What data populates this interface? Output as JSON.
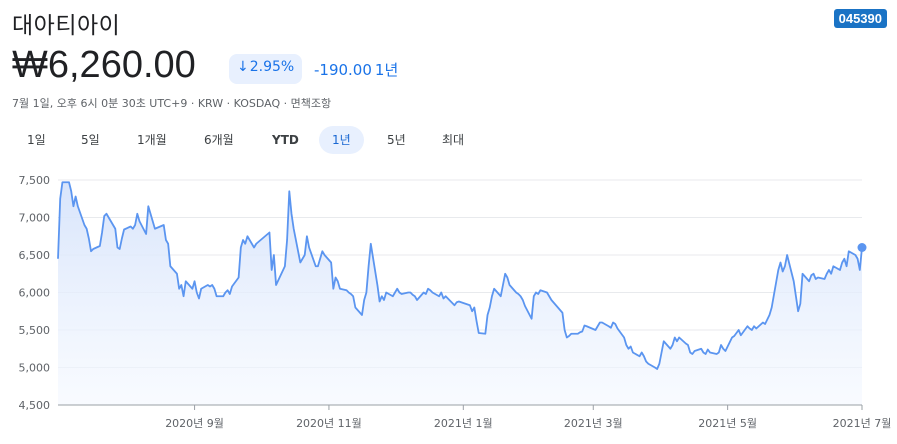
{
  "stock": {
    "name": "대아티아이",
    "ticker": "045390",
    "price": "₩6,260.00",
    "change_pct": "2.95%",
    "change_abs": "-190.00",
    "period": "1년",
    "meta": "7월 1일, 오후 6시 0분 30초 UTC+9 · KRW · KOSDAQ · 면책조항"
  },
  "tabs": [
    {
      "label": "1일"
    },
    {
      "label": "5일"
    },
    {
      "label": "1개월"
    },
    {
      "label": "6개월"
    },
    {
      "label": "YTD"
    },
    {
      "label": "1년",
      "active": true
    },
    {
      "label": "5년"
    },
    {
      "label": "최대"
    }
  ],
  "colors": {
    "line": "#5b95f0",
    "fill": "#e6eefc",
    "accent": "#1a73e8",
    "badge": "#1a73c5"
  },
  "chart_data": {
    "type": "area",
    "ylim": [
      4500,
      7500
    ],
    "yticks": [
      7500,
      7000,
      6500,
      6000,
      5500,
      5000,
      4500
    ],
    "ytick_labels": [
      "7,500",
      "7,000",
      "6,500",
      "6,000",
      "5,500",
      "5,000",
      "4,500"
    ],
    "xlim": [
      "2020-07-01",
      "2021-07-01"
    ],
    "xticks": [
      {
        "date": "2020-09-01",
        "label": "2020년 9월"
      },
      {
        "date": "2020-11-01",
        "label": "2020년 11월"
      },
      {
        "date": "2021-01-01",
        "label": "2021년 1월"
      },
      {
        "date": "2021-03-01",
        "label": "2021년 3월"
      },
      {
        "date": "2021-05-01",
        "label": "2021년 5월"
      },
      {
        "date": "2021-07-01",
        "label": "2021년 7월"
      }
    ],
    "x": [
      "2020-07-01",
      "2020-07-02",
      "2020-07-03",
      "2020-07-06",
      "2020-07-07",
      "2020-07-08",
      "2020-07-09",
      "2020-07-10",
      "2020-07-13",
      "2020-07-14",
      "2020-07-15",
      "2020-07-16",
      "2020-07-17",
      "2020-07-20",
      "2020-07-21",
      "2020-07-22",
      "2020-07-23",
      "2020-07-24",
      "2020-07-27",
      "2020-07-28",
      "2020-07-29",
      "2020-07-30",
      "2020-07-31",
      "2020-08-03",
      "2020-08-04",
      "2020-08-05",
      "2020-08-06",
      "2020-08-07",
      "2020-08-10",
      "2020-08-11",
      "2020-08-12",
      "2020-08-13",
      "2020-08-14",
      "2020-08-18",
      "2020-08-19",
      "2020-08-20",
      "2020-08-21",
      "2020-08-24",
      "2020-08-25",
      "2020-08-26",
      "2020-08-27",
      "2020-08-28",
      "2020-08-31",
      "2020-09-01",
      "2020-09-02",
      "2020-09-03",
      "2020-09-04",
      "2020-09-07",
      "2020-09-08",
      "2020-09-09",
      "2020-09-10",
      "2020-09-11",
      "2020-09-14",
      "2020-09-15",
      "2020-09-16",
      "2020-09-17",
      "2020-09-18",
      "2020-09-21",
      "2020-09-22",
      "2020-09-23",
      "2020-09-24",
      "2020-09-25",
      "2020-09-28",
      "2020-09-29",
      "2020-10-05",
      "2020-10-06",
      "2020-10-07",
      "2020-10-08",
      "2020-10-12",
      "2020-10-13",
      "2020-10-14",
      "2020-10-15",
      "2020-10-16",
      "2020-10-19",
      "2020-10-20",
      "2020-10-21",
      "2020-10-22",
      "2020-10-23",
      "2020-10-26",
      "2020-10-27",
      "2020-10-28",
      "2020-10-29",
      "2020-10-30",
      "2020-11-02",
      "2020-11-03",
      "2020-11-04",
      "2020-11-05",
      "2020-11-06",
      "2020-11-09",
      "2020-11-10",
      "2020-11-11",
      "2020-11-12",
      "2020-11-13",
      "2020-11-16",
      "2020-11-17",
      "2020-11-18",
      "2020-11-19",
      "2020-11-20",
      "2020-11-23",
      "2020-11-24",
      "2020-11-25",
      "2020-11-26",
      "2020-11-27",
      "2020-11-30",
      "2020-12-01",
      "2020-12-02",
      "2020-12-03",
      "2020-12-04",
      "2020-12-07",
      "2020-12-08",
      "2020-12-09",
      "2020-12-10",
      "2020-12-11",
      "2020-12-14",
      "2020-12-15",
      "2020-12-16",
      "2020-12-17",
      "2020-12-18",
      "2020-12-21",
      "2020-12-22",
      "2020-12-23",
      "2020-12-24",
      "2020-12-28",
      "2020-12-29",
      "2020-12-30",
      "2021-01-04",
      "2021-01-05",
      "2021-01-06",
      "2021-01-07",
      "2021-01-08",
      "2021-01-11",
      "2021-01-12",
      "2021-01-13",
      "2021-01-14",
      "2021-01-15",
      "2021-01-18",
      "2021-01-19",
      "2021-01-20",
      "2021-01-21",
      "2021-01-22",
      "2021-01-25",
      "2021-01-26",
      "2021-01-27",
      "2021-01-28",
      "2021-01-29",
      "2021-02-01",
      "2021-02-02",
      "2021-02-03",
      "2021-02-04",
      "2021-02-05",
      "2021-02-08",
      "2021-02-09",
      "2021-02-10",
      "2021-02-15",
      "2021-02-16",
      "2021-02-17",
      "2021-02-18",
      "2021-02-19",
      "2021-02-22",
      "2021-02-23",
      "2021-02-24",
      "2021-02-25",
      "2021-02-26",
      "2021-03-02",
      "2021-03-03",
      "2021-03-04",
      "2021-03-05",
      "2021-03-08",
      "2021-03-09",
      "2021-03-10",
      "2021-03-11",
      "2021-03-12",
      "2021-03-15",
      "2021-03-16",
      "2021-03-17",
      "2021-03-18",
      "2021-03-19",
      "2021-03-22",
      "2021-03-23",
      "2021-03-24",
      "2021-03-25",
      "2021-03-26",
      "2021-03-29",
      "2021-03-30",
      "2021-03-31",
      "2021-04-01",
      "2021-04-02",
      "2021-04-05",
      "2021-04-06",
      "2021-04-07",
      "2021-04-08",
      "2021-04-09",
      "2021-04-12",
      "2021-04-13",
      "2021-04-14",
      "2021-04-15",
      "2021-04-16",
      "2021-04-19",
      "2021-04-20",
      "2021-04-21",
      "2021-04-22",
      "2021-04-23",
      "2021-04-26",
      "2021-04-27",
      "2021-04-28",
      "2021-04-29",
      "2021-04-30",
      "2021-05-03",
      "2021-05-04",
      "2021-05-06",
      "2021-05-07",
      "2021-05-10",
      "2021-05-11",
      "2021-05-12",
      "2021-05-13",
      "2021-05-14",
      "2021-05-17",
      "2021-05-18",
      "2021-05-20",
      "2021-05-21",
      "2021-05-24",
      "2021-05-25",
      "2021-05-26",
      "2021-05-27",
      "2021-05-28",
      "2021-05-31",
      "2021-06-01",
      "2021-06-02",
      "2021-06-03",
      "2021-06-04",
      "2021-06-07",
      "2021-06-08",
      "2021-06-09",
      "2021-06-10",
      "2021-06-11",
      "2021-06-14",
      "2021-06-15",
      "2021-06-16",
      "2021-06-17",
      "2021-06-18",
      "2021-06-21",
      "2021-06-22",
      "2021-06-23",
      "2021-06-24",
      "2021-06-25",
      "2021-06-28",
      "2021-06-29",
      "2021-06-30",
      "2021-07-01"
    ],
    "series": [
      {
        "values": [
          6450,
          7250,
          7470,
          7470,
          7350,
          7150,
          7280,
          7150,
          6900,
          6850,
          6720,
          6550,
          6580,
          6620,
          6800,
          7020,
          7050,
          7000,
          6850,
          6600,
          6580,
          6720,
          6840,
          6880,
          6850,
          6900,
          7050,
          6950,
          6780,
          7150,
          7050,
          6950,
          6850,
          6900,
          6700,
          6650,
          6350,
          6250,
          6050,
          6100,
          5950,
          6150,
          6050,
          6150,
          6000,
          5920,
          6050,
          6100,
          6080,
          6100,
          6050,
          5950,
          5950,
          6000,
          6030,
          5980,
          6080,
          6200,
          6600,
          6700,
          6650,
          6750,
          6600,
          6650,
          6800,
          6300,
          6500,
          6100,
          6350,
          6700,
          7350,
          7050,
          6850,
          6400,
          6450,
          6500,
          6750,
          6600,
          6350,
          6350,
          6450,
          6550,
          6500,
          6400,
          6050,
          6200,
          6150,
          6050,
          6030,
          6000,
          5980,
          5950,
          5800,
          5700,
          5900,
          6000,
          6350,
          6650,
          6100,
          5880,
          5950,
          5900,
          6000,
          5950,
          6000,
          6050,
          6000,
          5980,
          6000,
          6000,
          5970,
          5950,
          5900,
          6000,
          5980,
          6050,
          6030,
          6000,
          5950,
          6000,
          5920,
          5950,
          5830,
          5870,
          5880,
          5830,
          5750,
          5800,
          5620,
          5460,
          5450,
          5700,
          5800,
          5950,
          6050,
          5950,
          6100,
          6250,
          6200,
          6100,
          6000,
          5980,
          5950,
          5900,
          5820,
          5650,
          5950,
          6000,
          5980,
          6030,
          6000,
          5950,
          5900,
          5730,
          5500,
          5400,
          5420,
          5450,
          5450,
          5470,
          5480,
          5560,
          5550,
          5500,
          5550,
          5600,
          5600,
          5550,
          5530,
          5600,
          5580,
          5520,
          5400,
          5300,
          5250,
          5280,
          5200,
          5150,
          5200,
          5150,
          5080,
          5050,
          5000,
          4980,
          5050,
          5200,
          5350,
          5250,
          5300,
          5400,
          5350,
          5400,
          5320,
          5300,
          5200,
          5180,
          5220,
          5250,
          5200,
          5180,
          5240,
          5200,
          5180,
          5200,
          5300,
          5250,
          5220,
          5400,
          5420,
          5500,
          5430,
          5550,
          5520,
          5500,
          5550,
          5520,
          5600,
          5580,
          5700,
          5800,
          6300,
          6400,
          6280,
          6350,
          6500,
          6150,
          5950,
          5750,
          5850,
          6250,
          6150,
          6230,
          6250,
          6180,
          6200,
          6180,
          6250,
          6300,
          6250,
          6350,
          6300,
          6400,
          6450,
          6350,
          6550,
          6500,
          6450,
          6300,
          6600,
          6880,
          6800,
          6500,
          6400,
          6200,
          6050,
          6250,
          6280,
          6250,
          6400,
          6320,
          6260
        ]
      }
    ]
  }
}
